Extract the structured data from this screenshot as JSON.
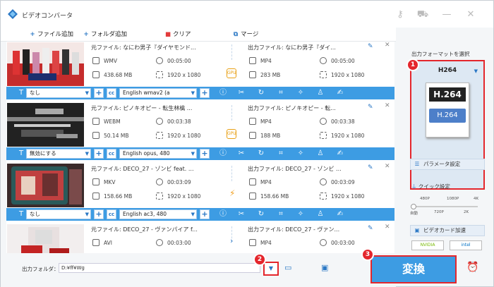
{
  "app": {
    "title": "ビデオコンバータ"
  },
  "toolbar": {
    "add_file": "ファイル追加",
    "add_folder": "フォルダ追加",
    "clear": "クリア",
    "merge": "マージ"
  },
  "items": [
    {
      "src_name": "元ファイル: なにわ男子『ダイヤモンド...",
      "src_format": "WMV",
      "src_duration": "00:05:00",
      "src_size": "438.68 MB",
      "src_res": "1920 x 1080",
      "out_name": "出力ファイル: なにわ男子『ダイ...",
      "out_format": "MP4",
      "out_duration": "00:05:00",
      "out_size": "283 MB",
      "out_res": "1920 x 1080",
      "subtitle": "なし",
      "audio": "English wmav2 (a"
    },
    {
      "src_name": "元ファイル: ピノキオピー - 転生林檎 ...",
      "src_format": "WEBM",
      "src_duration": "00:03:38",
      "src_size": "50.14 MB",
      "src_res": "1920 x 1080",
      "out_name": "出力ファイル: ピノキオピー - 転...",
      "out_format": "MP4",
      "out_duration": "00:03:38",
      "out_size": "188 MB",
      "out_res": "1920 x 1080",
      "subtitle": "無効にする",
      "audio": "English opus, 480"
    },
    {
      "src_name": "元ファイル: DECO_27 - ゾンビ feat. ...",
      "src_format": "MKV",
      "src_duration": "00:03:09",
      "src_size": "158.66 MB",
      "src_res": "1920 x 1080",
      "out_name": "出力ファイル: DECO_27 - ゾンビ ...",
      "out_format": "MP4",
      "out_duration": "00:03:09",
      "out_size": "158.66 MB",
      "out_res": "1920 x 1080",
      "subtitle": "なし",
      "audio": "English ac3, 480"
    },
    {
      "src_name": "元ファイル: DECO_27 - ヴァンパイア f...",
      "src_format": "AVI",
      "src_duration": "00:03:00",
      "src_size": "",
      "src_res": "",
      "out_name": "出力ファイル: DECO_27 - ヴァン...",
      "out_format": "MP4",
      "out_duration": "00:03:00",
      "out_size": "",
      "out_res": "",
      "subtitle": "",
      "audio": ""
    }
  ],
  "output": {
    "label": "出力フォルダ：",
    "path": "D:¥ff¥Wg"
  },
  "convert": {
    "label": "変換"
  },
  "side": {
    "title": "出力フォーマットを選択",
    "format": "H264",
    "format_icon_top": "H.264",
    "format_icon_bottom": "H.264",
    "param_label": "パラメータ設定",
    "quick_label": "クイック設定",
    "q_marks_top": [
      "480P",
      "1080P",
      "4K"
    ],
    "q_marks_bottom": [
      "自動",
      "720P",
      "2K"
    ],
    "gpu_label": "ビデオカード加速",
    "nvidia": "NVIDIA",
    "intel": "intel"
  },
  "badges": [
    "1",
    "2",
    "3"
  ],
  "colors": {
    "accent": "#3d9ce3",
    "highlight": "#e4262c",
    "gpu": "#e8a015"
  }
}
